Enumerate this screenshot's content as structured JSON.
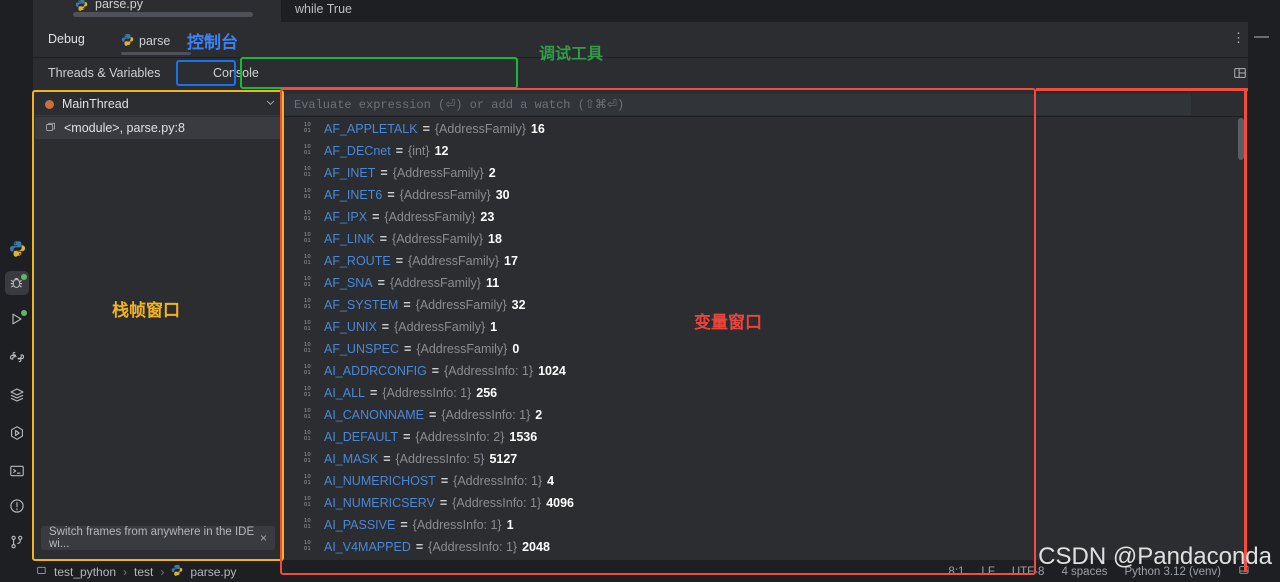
{
  "editor": {
    "tab_label": "parse.py",
    "code_line": "while True"
  },
  "debug": {
    "title": "Debug",
    "run_config": "parse",
    "close_glyph": "×",
    "more_glyph": "⋮",
    "minimize_glyph": "—",
    "tabs": [
      {
        "label": "Threads & Variables"
      },
      {
        "label": "Console"
      }
    ],
    "toolbar_icons": [
      "rerun-icon",
      "stop-icon",
      "resume-icon",
      "pause-icon",
      "show-execution-point-icon",
      "step-over-icon",
      "step-into-icon",
      "step-out-icon",
      "view-breakpoints-icon",
      "mute-breakpoints-icon",
      "more-options-icon"
    ]
  },
  "frames": {
    "thread_name": "MainThread",
    "thread_chevron": "⌄",
    "frame_label": "<module>, parse.py:8",
    "hint_text": "Switch frames from anywhere in the IDE wi...",
    "hint_close": "×"
  },
  "variables": {
    "eval_placeholder": "Evaluate expression (⏎) or add a watch (⇧⌘⏎)",
    "rows": [
      {
        "name": "AF_APPLETALK",
        "type": "{AddressFamily}",
        "value": "16"
      },
      {
        "name": "AF_DECnet",
        "type": "{int}",
        "value": "12"
      },
      {
        "name": "AF_INET",
        "type": "{AddressFamily}",
        "value": "2"
      },
      {
        "name": "AF_INET6",
        "type": "{AddressFamily}",
        "value": "30"
      },
      {
        "name": "AF_IPX",
        "type": "{AddressFamily}",
        "value": "23"
      },
      {
        "name": "AF_LINK",
        "type": "{AddressFamily}",
        "value": "18"
      },
      {
        "name": "AF_ROUTE",
        "type": "{AddressFamily}",
        "value": "17"
      },
      {
        "name": "AF_SNA",
        "type": "{AddressFamily}",
        "value": "11"
      },
      {
        "name": "AF_SYSTEM",
        "type": "{AddressFamily}",
        "value": "32"
      },
      {
        "name": "AF_UNIX",
        "type": "{AddressFamily}",
        "value": "1"
      },
      {
        "name": "AF_UNSPEC",
        "type": "{AddressFamily}",
        "value": "0"
      },
      {
        "name": "AI_ADDRCONFIG",
        "type": "{AddressInfo: 1}",
        "value": "1024"
      },
      {
        "name": "AI_ALL",
        "type": "{AddressInfo: 1}",
        "value": "256"
      },
      {
        "name": "AI_CANONNAME",
        "type": "{AddressInfo: 1}",
        "value": "2"
      },
      {
        "name": "AI_DEFAULT",
        "type": "{AddressInfo: 2}",
        "value": "1536"
      },
      {
        "name": "AI_MASK",
        "type": "{AddressInfo: 5}",
        "value": "5127"
      },
      {
        "name": "AI_NUMERICHOST",
        "type": "{AddressInfo: 1}",
        "value": "4"
      },
      {
        "name": "AI_NUMERICSERV",
        "type": "{AddressInfo: 1}",
        "value": "4096"
      },
      {
        "name": "AI_PASSIVE",
        "type": "{AddressInfo: 1}",
        "value": "1"
      },
      {
        "name": "AI_V4MAPPED",
        "type": "{AddressInfo: 1}",
        "value": "2048"
      }
    ]
  },
  "rail_icons": [
    "python-icon",
    "debug-icon",
    "run-icon",
    "python-console-icon",
    "layers-icon",
    "services-icon",
    "terminal-icon",
    "problems-icon",
    "git-icon"
  ],
  "statusbar": {
    "breadcrumb": [
      "test_python",
      "test",
      "parse.py"
    ],
    "separator": "›",
    "caret": "8:1",
    "line_sep": "LF",
    "encoding": "UTF-8",
    "indent": "4 spaces",
    "interpreter": "Python 3.12 (venv)"
  },
  "annotations": {
    "console": "控制台",
    "toolbar": "调试工具",
    "frames": "栈帧窗口",
    "variables": "变量窗口",
    "colors": {
      "console_box": "#1a73e8",
      "toolbar_box": "#19b83b",
      "frames_box": "#f0b323",
      "variables_box": "#f24c3d"
    }
  },
  "watermark": "CSDN @Pandaconda"
}
